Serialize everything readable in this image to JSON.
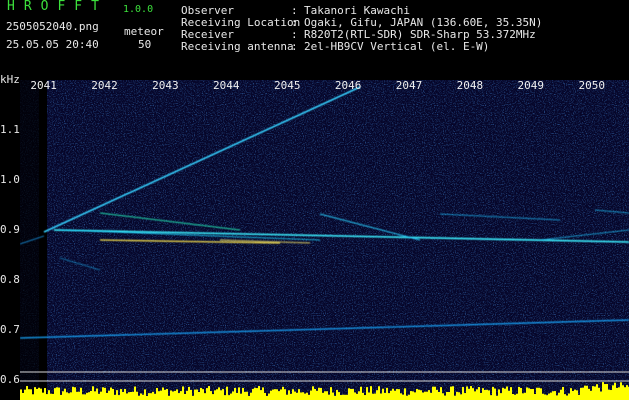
{
  "header": {
    "app_name": "HROFFT",
    "app_version": "1.0.0",
    "file_name": "2505052040.png",
    "date_time": "25.05.05 20:40",
    "meteor_label": "meteor",
    "meteor_count": "50"
  },
  "info": [
    {
      "label": "Observer",
      "value": "Takanori Kawachi"
    },
    {
      "label": "Receiving Location",
      "value": "Ogaki, Gifu, JAPAN (136.60E, 35.35N)"
    },
    {
      "label": "Receiver",
      "value": "R820T2(RTL-SDR) SDR-Sharp 53.372MHz"
    },
    {
      "label": "Receiving antenna",
      "value": "2el-HB9CV Vertical (el. E-W)"
    }
  ],
  "colon": ":",
  "chart_data": {
    "type": "heatmap",
    "ylabel": "kHz",
    "x_ticks": [
      "2041",
      "2042",
      "2043",
      "2044",
      "2045",
      "2046",
      "2047",
      "2048",
      "2049",
      "2050"
    ],
    "y_ticks": [
      "1.1",
      "1.0",
      "0.9",
      "0.8",
      "0.7",
      "0.6"
    ],
    "y_tick_values": [
      1.1,
      1.0,
      0.9,
      0.8,
      0.7,
      0.6
    ],
    "x_range": [
      2040.6,
      2050.6
    ],
    "y_range": [
      0.6,
      1.22
    ],
    "carrier_khz": 0.875,
    "colors": {
      "background": "#06062a",
      "trace": "#1ec8ff",
      "hot": "#ffe84a",
      "level": "#ffff00"
    }
  }
}
